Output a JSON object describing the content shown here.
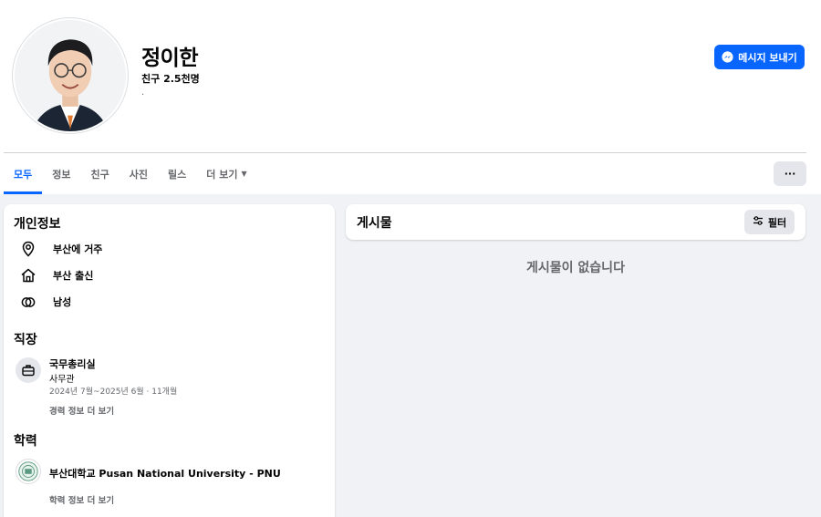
{
  "profile": {
    "name": "정이한",
    "friends": "친구 2.5천명",
    "bio": ".",
    "message_button": "메시지 보내기"
  },
  "tabs": [
    "모두",
    "정보",
    "친구",
    "사진",
    "릴스",
    "더 보기"
  ],
  "more_options": "···",
  "intro": {
    "title": "개인정보",
    "items": [
      "부산에 거주",
      "부산 출신",
      "남성"
    ]
  },
  "work": {
    "title": "직장",
    "company": "국무총리실",
    "role": "사무관",
    "period": "2024년 7월~2025년 6월 · 11개월",
    "more": "경력 정보 더 보기"
  },
  "education": {
    "title": "학력",
    "school": "부산대학교 Pusan National University - PNU",
    "more": "학력 정보 더 보기"
  },
  "posts": {
    "title": "게시물",
    "filter": "필터",
    "empty": "게시물이 없습니다"
  },
  "colors": {
    "accent": "#0866ff",
    "muted": "#65676b",
    "background": "#f0f2f5"
  }
}
